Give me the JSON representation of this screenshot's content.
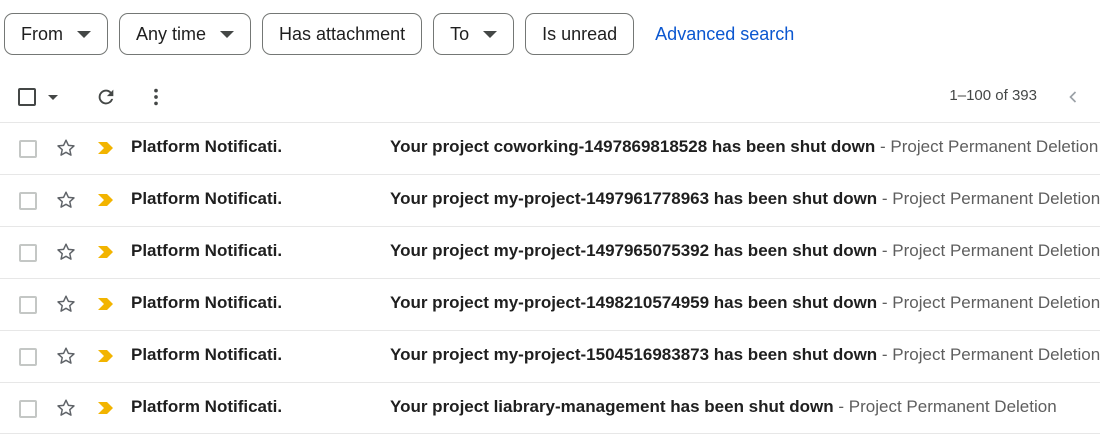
{
  "filters": {
    "chips": [
      {
        "label": "From",
        "dropdown": true
      },
      {
        "label": "Any time",
        "dropdown": true
      },
      {
        "label": "Has attachment",
        "dropdown": false
      },
      {
        "label": "To",
        "dropdown": true
      },
      {
        "label": "Is unread",
        "dropdown": false
      }
    ],
    "advanced_search": "Advanced search"
  },
  "toolbar": {
    "range_text": "1–100 of 393",
    "icons": [
      "checkbox-select-all",
      "chevron-down-icon",
      "refresh-icon",
      "more-vert-icon",
      "chevron-left-icon"
    ]
  },
  "emails": [
    {
      "sender": "Platform Notificati.",
      "subject": "Your project coworking-1497869818528 has been shut down",
      "snippet": " - Project Permanent Deletion"
    },
    {
      "sender": "Platform Notificati.",
      "subject": "Your project my-project-1497961778963 has been shut down",
      "snippet": " - Project Permanent Deletion"
    },
    {
      "sender": "Platform Notificati.",
      "subject": "Your project my-project-1497965075392 has been shut down",
      "snippet": " - Project Permanent Deletion"
    },
    {
      "sender": "Platform Notificati.",
      "subject": "Your project my-project-1498210574959 has been shut down",
      "snippet": " - Project Permanent Deletion"
    },
    {
      "sender": "Platform Notificati.",
      "subject": "Your project my-project-1504516983873 has been shut down",
      "snippet": " - Project Permanent Deletion"
    },
    {
      "sender": "Platform Notificati.",
      "subject": "Your project liabrary-management has been shut down",
      "snippet": " - Project Permanent Deletion"
    }
  ],
  "colors": {
    "link": "#0b57d0",
    "important_marker": "#f2b400",
    "text": "#1f1f1f",
    "snippet": "#5e5e5e"
  }
}
